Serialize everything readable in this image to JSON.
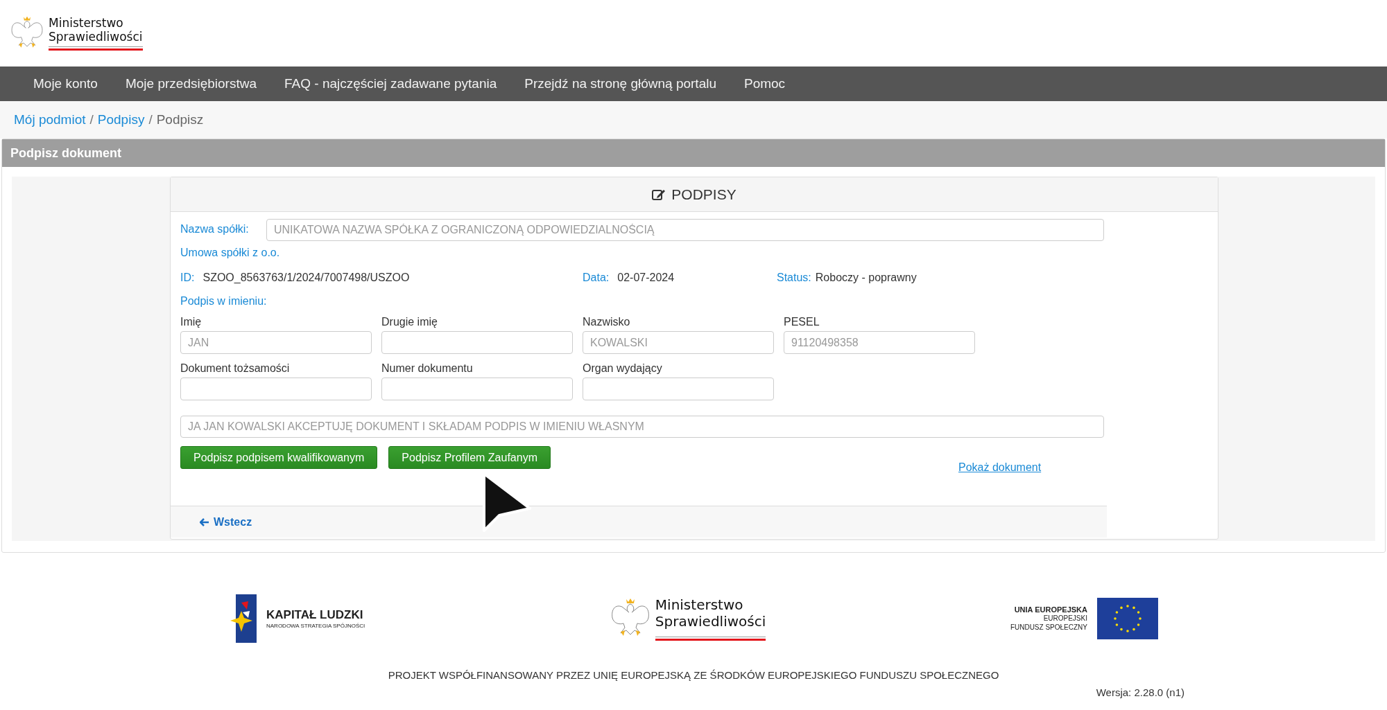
{
  "header": {
    "logo_line1": "Ministerstwo",
    "logo_line2": "Sprawiedliwości"
  },
  "nav": [
    {
      "label": "Moje konto"
    },
    {
      "label": "Moje przedsiębiorstwa"
    },
    {
      "label": "FAQ - najczęściej zadawane pytania"
    },
    {
      "label": "Przejdź na stronę główną portalu"
    },
    {
      "label": "Pomoc"
    }
  ],
  "breadcrumb": [
    {
      "label": "Mój podmiot",
      "link": true
    },
    {
      "label": "Podpisy",
      "link": true
    },
    {
      "label": "Podpisz",
      "link": false
    }
  ],
  "breadcrumb_separator": "/",
  "panel_title": "Podpisz dokument",
  "card": {
    "title": "PODPISY",
    "company_label": "Nazwa spółki:",
    "company_value": "UNIKATOWA NAZWA SPÓŁKA Z OGRANICZONĄ ODPOWIEDZIALNOŚCIĄ",
    "contract_type": "Umowa spółki z o.o.",
    "meta": [
      {
        "label": "ID:",
        "value": "SZOO_8563763/1/2024/7007498/USZOO"
      },
      {
        "label": "Data:",
        "value": "02-07-2024"
      },
      {
        "label": "Status:",
        "value": "Roboczy - poprawny"
      }
    ],
    "section_label": "Podpis w imieniu:",
    "field_rows": [
      [
        {
          "label": "Imię",
          "placeholder": "JAN"
        },
        {
          "label": "Drugie imię"
        },
        {
          "label": "Nazwisko",
          "placeholder": "KOWALSKI"
        },
        {
          "label": "PESEL",
          "placeholder": "91120498358"
        }
      ],
      [
        {
          "label": "Dokument tożsamości"
        },
        {
          "label": "Numer dokumentu"
        },
        {
          "label": "Organ wydający"
        }
      ]
    ],
    "declaration": "JA JAN KOWALSKI AKCEPTUJĘ DOKUMENT I SKŁADAM PODPIS W IMIENIU WŁASNYM",
    "buttons": [
      "Podpisz podpisem kwalifikowanym",
      "Podpisz Profilem Zaufanym"
    ],
    "show_document": "Pokaż dokument",
    "back": "Wstecz"
  },
  "footer": {
    "kl_title": "KAPITAŁ LUDZKI",
    "kl_subtitle": "NARODOWA STRATEGIA SPÓJNOŚCI",
    "ms_line1": "Ministerstwo",
    "ms_line2": "Sprawiedliwości",
    "eu_line1": "UNIA EUROPEJSKA",
    "eu_line2": "EUROPEJSKI",
    "eu_line3": "FUNDUSZ SPOŁECZNY",
    "project": "PROJEKT WSPÓŁFINANSOWANY PRZEZ UNIĘ EUROPEJSKĄ ZE ŚRODKÓW EUROPEJSKIEGO FUNDUSZU SPOŁECZNEGO",
    "version": "Wersja: 2.28.0 (n1)"
  }
}
